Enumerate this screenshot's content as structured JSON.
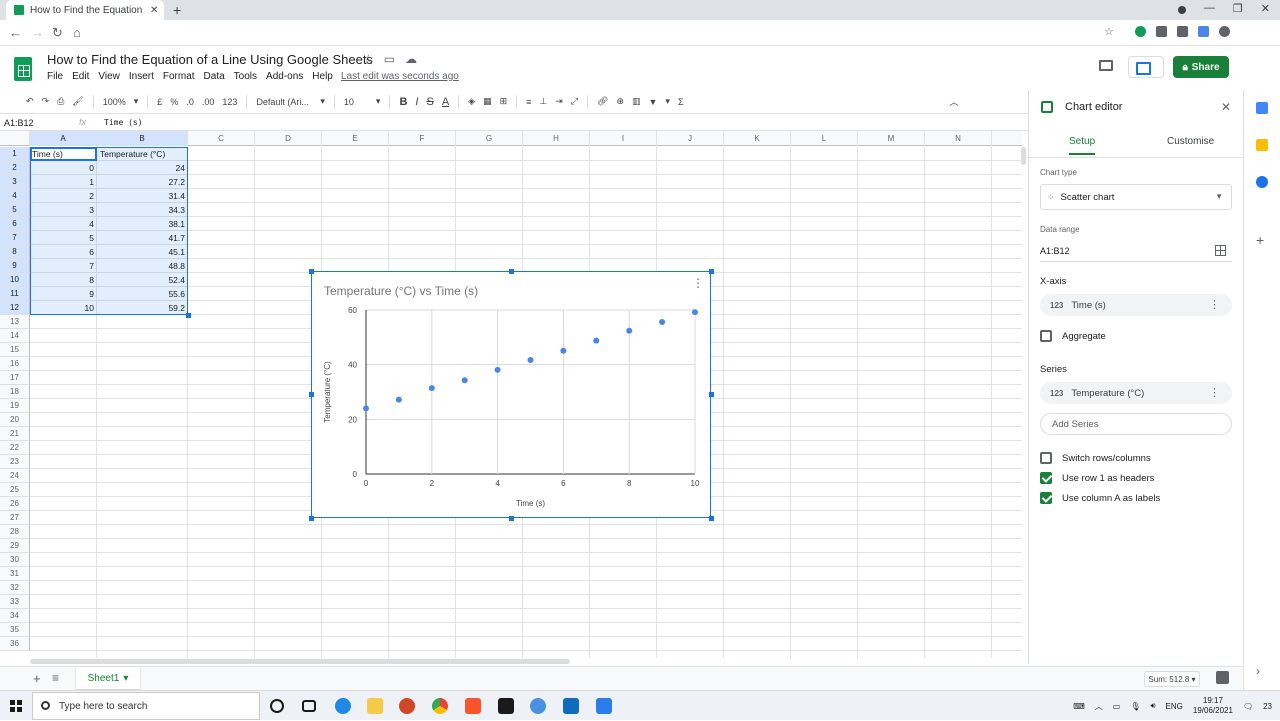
{
  "browser": {
    "tab_title": "How to Find the Equation of a Line Using Google Sheets",
    "tab_close": "✕",
    "new_tab": "+"
  },
  "doc": {
    "title": "How to Find the Equation of a Line Using Google Sheets",
    "last_edit": "Last edit was seconds ago",
    "share_label": "Share",
    "menus": [
      "File",
      "Edit",
      "View",
      "Insert",
      "Format",
      "Data",
      "Tools",
      "Add-ons",
      "Help"
    ]
  },
  "toolbar": {
    "zoom": "100%",
    "currency": "£",
    "percent": "%",
    "dec_minus": ".0",
    "dec_plus": ".00",
    "more_formats": "123",
    "font": "Default (Ari...",
    "font_size": "10",
    "bold": "B",
    "italic": "I",
    "strike": "S",
    "text_color": "A",
    "functions": "Σ"
  },
  "formula_bar": {
    "name_box": "A1:B12",
    "fx": "fx",
    "formula": "Time (s)"
  },
  "grid": {
    "columns": [
      "A",
      "B",
      "C",
      "D",
      "E",
      "F",
      "G",
      "H",
      "I",
      "J",
      "K",
      "L",
      "M",
      "N"
    ],
    "rows": [
      "1",
      "2",
      "3",
      "4",
      "5",
      "6",
      "7",
      "8",
      "9",
      "10",
      "11",
      "12",
      "13",
      "14",
      "15",
      "16",
      "17",
      "18",
      "19",
      "20",
      "21",
      "22",
      "23",
      "24",
      "25",
      "26",
      "27",
      "28",
      "29",
      "30",
      "31",
      "32",
      "33",
      "34",
      "35",
      "36"
    ],
    "header_a": "Time (s)",
    "header_b": "Temperature (°C)",
    "col_a": [
      "0",
      "1",
      "2",
      "3",
      "4",
      "5",
      "6",
      "7",
      "8",
      "9",
      "10"
    ],
    "col_b": [
      "24",
      "27.2",
      "31.4",
      "34.3",
      "38.1",
      "41.7",
      "45.1",
      "48.8",
      "52.4",
      "55.6",
      "59.2"
    ]
  },
  "chart_data": {
    "type": "scatter",
    "title": "Temperature (°C) vs Time (s)",
    "xlabel": "Time (s)",
    "ylabel": "Temperature (°C)",
    "x": [
      0,
      1,
      2,
      3,
      4,
      5,
      6,
      7,
      8,
      9,
      10
    ],
    "y": [
      24,
      27.2,
      31.4,
      34.3,
      38.1,
      41.7,
      45.1,
      48.8,
      52.4,
      55.6,
      59.2
    ],
    "xlim": [
      0,
      10
    ],
    "ylim": [
      0,
      60
    ],
    "xticks": [
      0,
      2,
      4,
      6,
      8,
      10
    ],
    "yticks": [
      0,
      20,
      40,
      60
    ],
    "grid": true,
    "point_color": "#4a86e8"
  },
  "sheet_bar": {
    "add": "+",
    "sheet_name": "Sheet1",
    "sum": "Sum: 512.8"
  },
  "editor": {
    "title": "Chart editor",
    "tab_setup": "Setup",
    "tab_customise": "Customise",
    "chart_type_label": "Chart type",
    "chart_type_value": "Scatter chart",
    "data_range_label": "Data range",
    "data_range_value": "A1:B12",
    "x_axis_label": "X-axis",
    "x_axis_value": "Time (s)",
    "aggregate_label": "Aggregate",
    "series_label": "Series",
    "series_value": "Temperature (°C)",
    "add_series": "Add Series",
    "switch_rows": "Switch rows/columns",
    "row1_headers": "Use row 1 as headers",
    "colA_labels": "Use column A as labels",
    "type_badge": "123",
    "aggregate_checked": false,
    "switch_checked": false,
    "row1_checked": true,
    "colA_checked": true
  },
  "taskbar": {
    "search_placeholder": "Type here to search",
    "lang": "ENG",
    "time": "19:17",
    "date": "19/06/2021",
    "notifications": "23"
  },
  "colors": {
    "accent_green": "#188038",
    "selection_blue": "#1a73e8"
  }
}
